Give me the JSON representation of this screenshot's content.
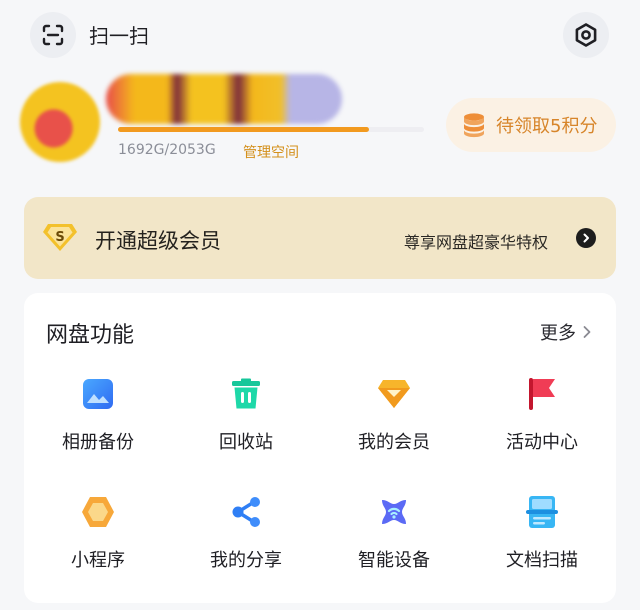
{
  "header": {
    "scan_label": "扫一扫"
  },
  "profile": {
    "storage_text": "1692G/2053G",
    "storage_used_fraction": 0.82,
    "manage_label": "管理空间",
    "points_label": "待领取5积分"
  },
  "vip": {
    "badge_letter": "S",
    "title": "开通超级会员",
    "subtitle": "尊享网盘超豪华特权"
  },
  "functions": {
    "title": "网盘功能",
    "more_label": "更多",
    "items": [
      {
        "label": "相册备份",
        "icon": "photo-album-icon"
      },
      {
        "label": "回收站",
        "icon": "trash-bin-icon"
      },
      {
        "label": "我的会员",
        "icon": "diamond-icon"
      },
      {
        "label": "活动中心",
        "icon": "flag-icon"
      },
      {
        "label": "小程序",
        "icon": "mini-program-icon"
      },
      {
        "label": "我的分享",
        "icon": "share-icon"
      },
      {
        "label": "智能设备",
        "icon": "smart-device-icon"
      },
      {
        "label": "文档扫描",
        "icon": "document-scan-icon"
      }
    ]
  },
  "colors": {
    "accent": "#f29a1f",
    "vip_banner": "#f2e6c8",
    "link": "#d4901c"
  }
}
